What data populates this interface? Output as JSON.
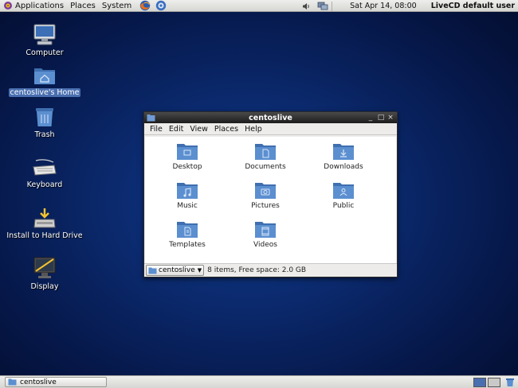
{
  "top_panel": {
    "menus": [
      "Applications",
      "Places",
      "System"
    ],
    "clock": "Sat Apr 14, 08:00",
    "user": "LiveCD default user"
  },
  "desktop_icons": [
    {
      "label": "Computer",
      "icon": "computer-icon"
    },
    {
      "label": "centoslive's Home",
      "icon": "home-folder-icon",
      "selected": true
    },
    {
      "label": "Trash",
      "icon": "trash-icon"
    },
    {
      "label": "Keyboard",
      "icon": "keyboard-icon"
    },
    {
      "label": "Install to Hard Drive",
      "icon": "install-icon"
    },
    {
      "label": "Display",
      "icon": "display-icon"
    }
  ],
  "window": {
    "title": "centoslive",
    "menu": [
      "File",
      "Edit",
      "View",
      "Places",
      "Help"
    ],
    "items": [
      {
        "label": "Desktop",
        "icon": "desktop-folder-icon"
      },
      {
        "label": "Documents",
        "icon": "documents-folder-icon"
      },
      {
        "label": "Downloads",
        "icon": "downloads-folder-icon"
      },
      {
        "label": "Music",
        "icon": "music-folder-icon"
      },
      {
        "label": "Pictures",
        "icon": "pictures-folder-icon"
      },
      {
        "label": "Public",
        "icon": "public-folder-icon"
      },
      {
        "label": "Templates",
        "icon": "templates-folder-icon"
      },
      {
        "label": "Videos",
        "icon": "videos-folder-icon"
      }
    ],
    "location": "centoslive",
    "status": "8 items, Free space: 2.0 GB"
  },
  "bottom_panel": {
    "task_label": "centoslive"
  },
  "colors": {
    "folder": "#5b8fd0",
    "folder_dark": "#3f6fb0",
    "selection": "#4a6fb0"
  }
}
